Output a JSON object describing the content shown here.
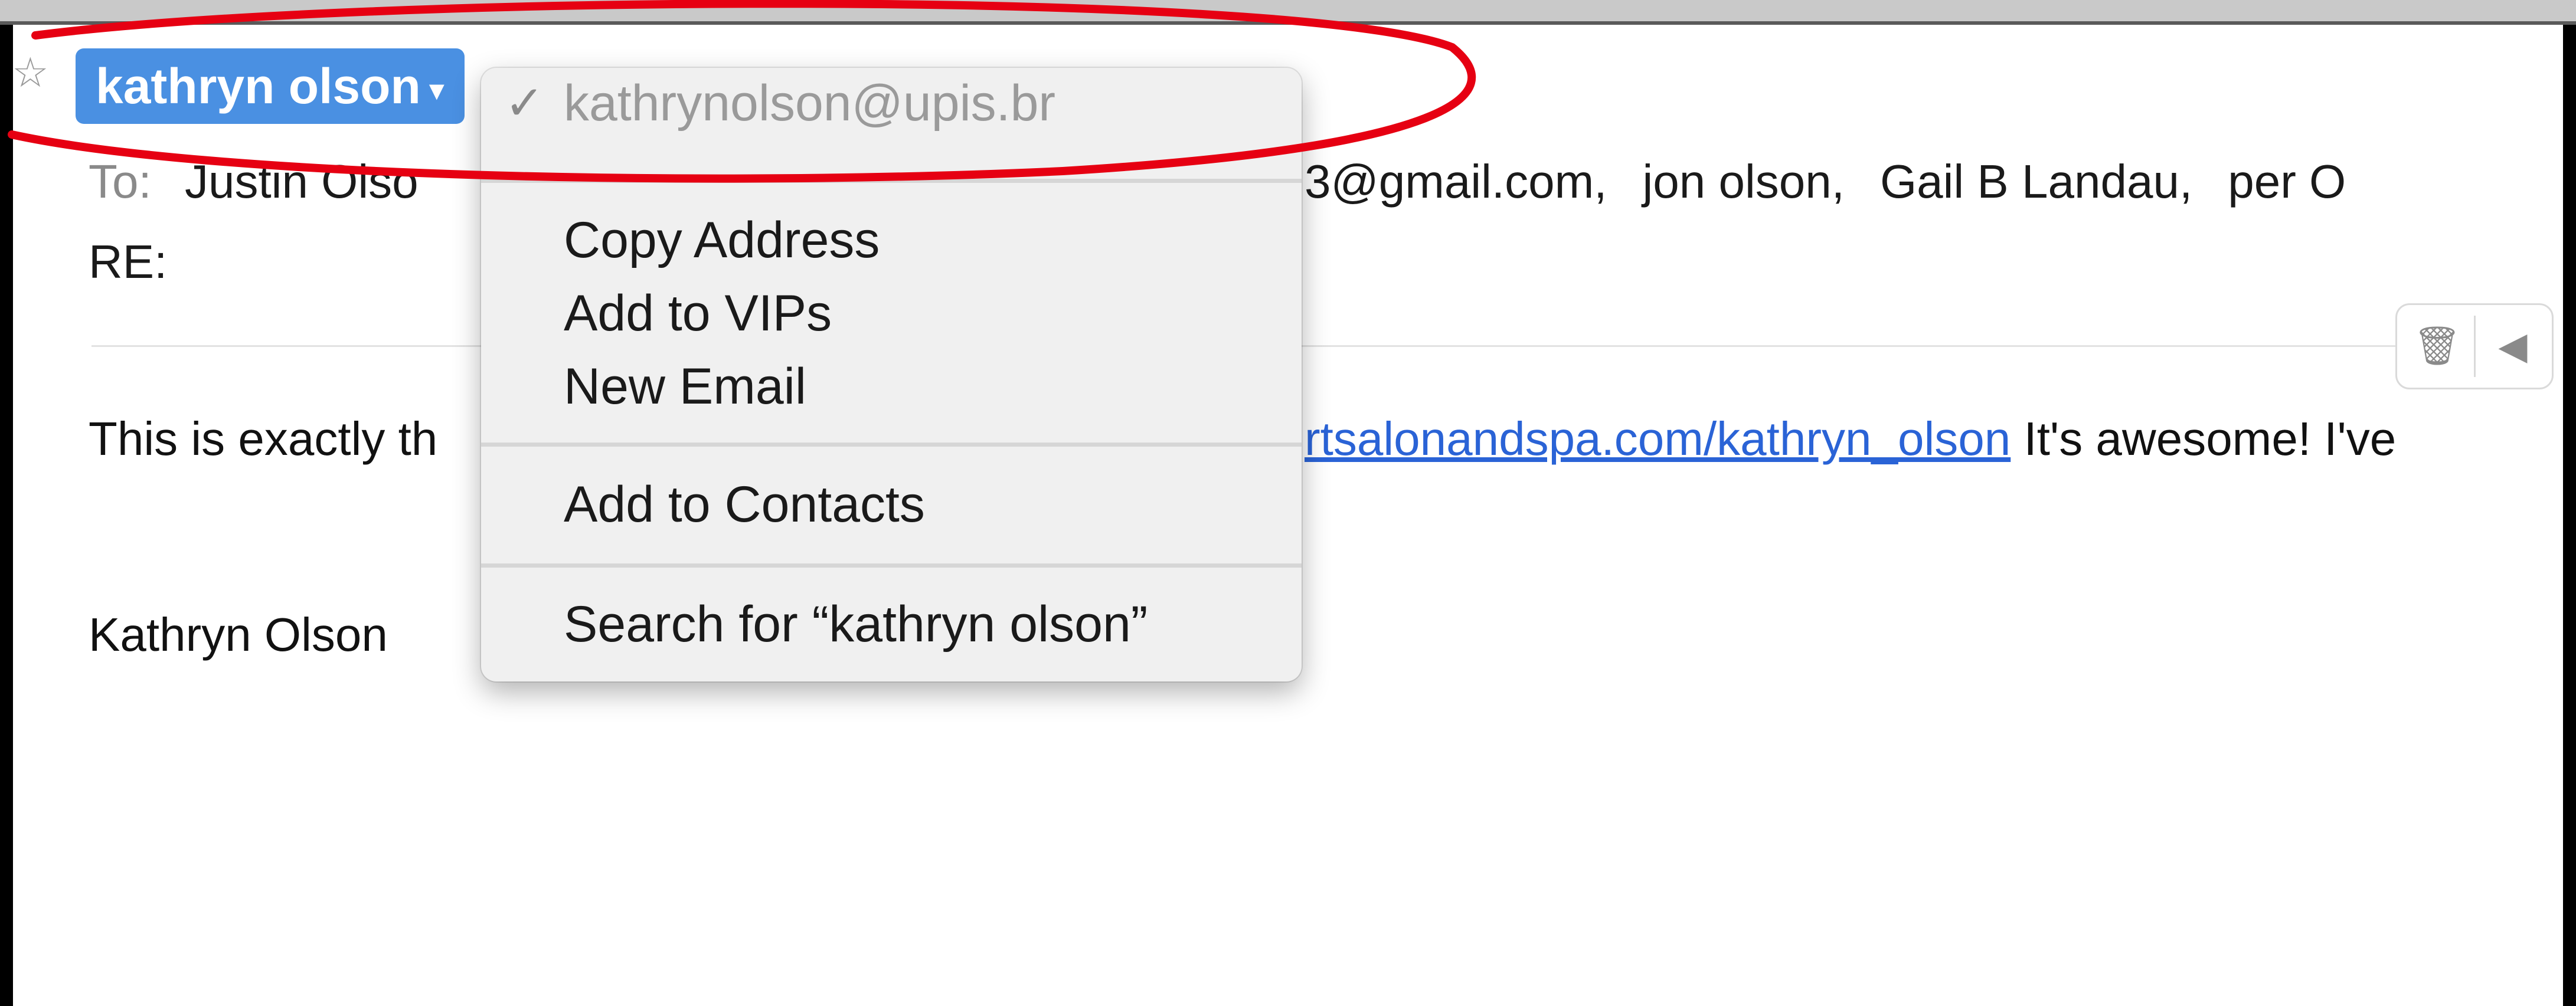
{
  "sender": {
    "name": "kathryn olson",
    "chevron": "▾"
  },
  "icons": {
    "star": "star-outline-icon",
    "check": "checkmark-icon",
    "trash": "trash-icon",
    "reply": "reply-arrow-icon"
  },
  "header": {
    "to_label": "To:",
    "recipient_1": "Justin Olso",
    "recipient_2": "3@gmail.com,",
    "recipient_3": "jon olson,",
    "recipient_4": "Gail B Landau,",
    "recipient_5": "per O",
    "subject": "RE:"
  },
  "message": {
    "line_start": "This is exactly th",
    "link_text": "rtsalonandspa.com/kathryn_olson",
    "line_end": " It's awesome! I've ",
    "signature": "Kathryn Olson"
  },
  "context_menu": {
    "email_item": "kathrynolson@upis.br",
    "check_mark": "✓",
    "copy_address": "Copy Address",
    "add_vips": "Add to VIPs",
    "new_email": "New Email",
    "add_contacts": "Add to Contacts",
    "search": "Search for “kathryn olson”"
  },
  "colors": {
    "sender_pill": "#4a90e2",
    "annotation_ring": "#e60012",
    "link": "#2a63d6"
  }
}
